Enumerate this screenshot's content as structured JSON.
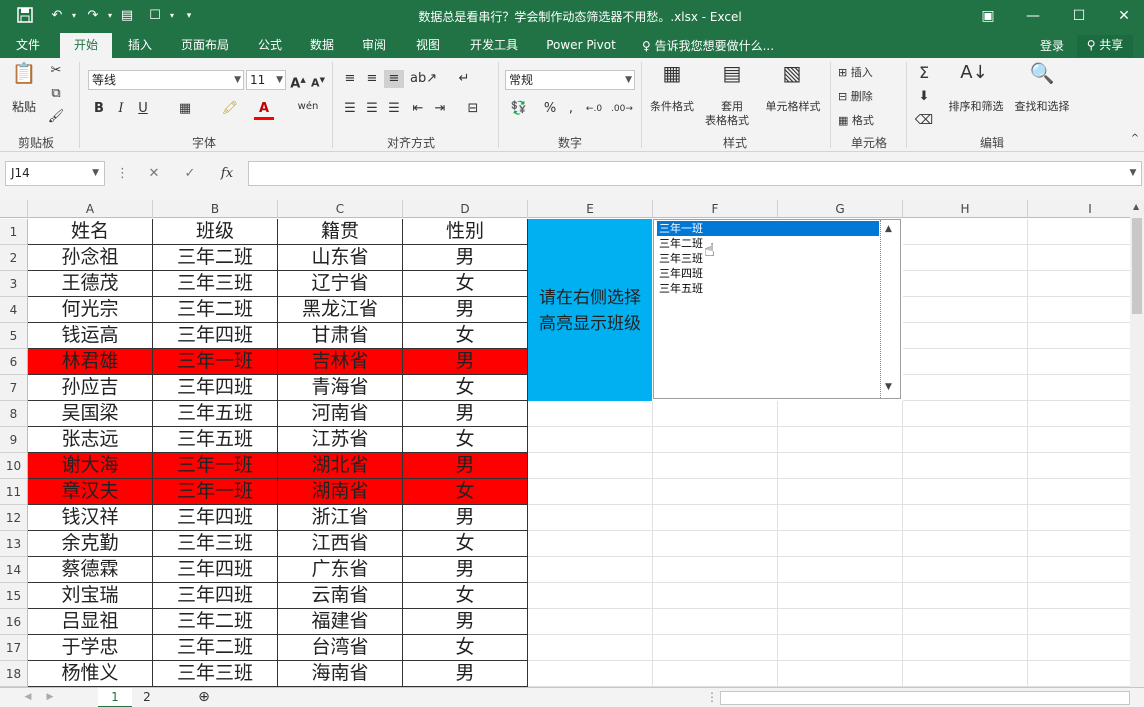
{
  "window": {
    "title": "数据总是看串行？学会制作动态筛选器不用愁。.xlsx - Excel"
  },
  "ribbon_tabs": [
    "文件",
    "开始",
    "插入",
    "页面布局",
    "公式",
    "数据",
    "审阅",
    "视图",
    "开发工具",
    "Power Pivot"
  ],
  "active_tab": "开始",
  "tell_me": "告诉我您想要做什么...",
  "login": "登录",
  "share": "共享",
  "ribbon": {
    "paste": "粘贴",
    "font_name": "等线",
    "font_size": "11",
    "number_format": "常规",
    "conditional_format": "条件格式",
    "table_format_1": "套用",
    "table_format_2": "表格格式",
    "cell_styles": "单元格样式",
    "insert": "插入",
    "delete": "删除",
    "format": "格式",
    "sort_filter": "排序和筛选",
    "find_select": "查找和选择",
    "groups": {
      "clipboard": "剪贴板",
      "font": "字体",
      "alignment": "对齐方式",
      "number": "数字",
      "styles": "样式",
      "cells": "单元格",
      "editing": "编辑"
    }
  },
  "name_box": "J14",
  "fx": "fx",
  "columns": [
    "A",
    "B",
    "C",
    "D",
    "E",
    "F",
    "G",
    "H",
    "I"
  ],
  "rows": [
    "1",
    "2",
    "3",
    "4",
    "5",
    "6",
    "7",
    "8",
    "9",
    "10",
    "11",
    "12",
    "13",
    "14",
    "15",
    "16",
    "17",
    "18"
  ],
  "table": {
    "headers": [
      "姓名",
      "班级",
      "籍贯",
      "性别"
    ],
    "rows": [
      [
        "孙念祖",
        "三年二班",
        "山东省",
        "男"
      ],
      [
        "王德茂",
        "三年三班",
        "辽宁省",
        "女"
      ],
      [
        "何光宗",
        "三年二班",
        "黑龙江省",
        "男"
      ],
      [
        "钱运高",
        "三年四班",
        "甘肃省",
        "女"
      ],
      [
        "林君雄",
        "三年一班",
        "吉林省",
        "男"
      ],
      [
        "孙应吉",
        "三年四班",
        "青海省",
        "女"
      ],
      [
        "吴国梁",
        "三年五班",
        "河南省",
        "男"
      ],
      [
        "张志远",
        "三年五班",
        "江苏省",
        "女"
      ],
      [
        "谢大海",
        "三年一班",
        "湖北省",
        "男"
      ],
      [
        "章汉夫",
        "三年一班",
        "湖南省",
        "女"
      ],
      [
        "钱汉祥",
        "三年四班",
        "浙江省",
        "男"
      ],
      [
        "余克勤",
        "三年三班",
        "江西省",
        "女"
      ],
      [
        "蔡德霖",
        "三年四班",
        "广东省",
        "男"
      ],
      [
        "刘宝瑞",
        "三年四班",
        "云南省",
        "女"
      ],
      [
        "吕显祖",
        "三年二班",
        "福建省",
        "男"
      ],
      [
        "于学忠",
        "三年二班",
        "台湾省",
        "女"
      ],
      [
        "杨惟义",
        "三年三班",
        "海南省",
        "男"
      ]
    ],
    "highlight_color": "#ff0000",
    "highlight_class": "三年一班"
  },
  "instruction_line1": "请在右侧选择",
  "instruction_line2": "高亮显示班级",
  "listbox": {
    "items": [
      "三年一班",
      "三年二班",
      "三年三班",
      "三年四班",
      "三年五班"
    ],
    "selected_item": "三年一班"
  },
  "sheet_tabs": [
    "1",
    "2"
  ],
  "active_sheet": "1",
  "colors": {
    "excel_green": "#217346",
    "instruction_bg": "#00b0f0",
    "selection_blue": "#0078d7"
  }
}
